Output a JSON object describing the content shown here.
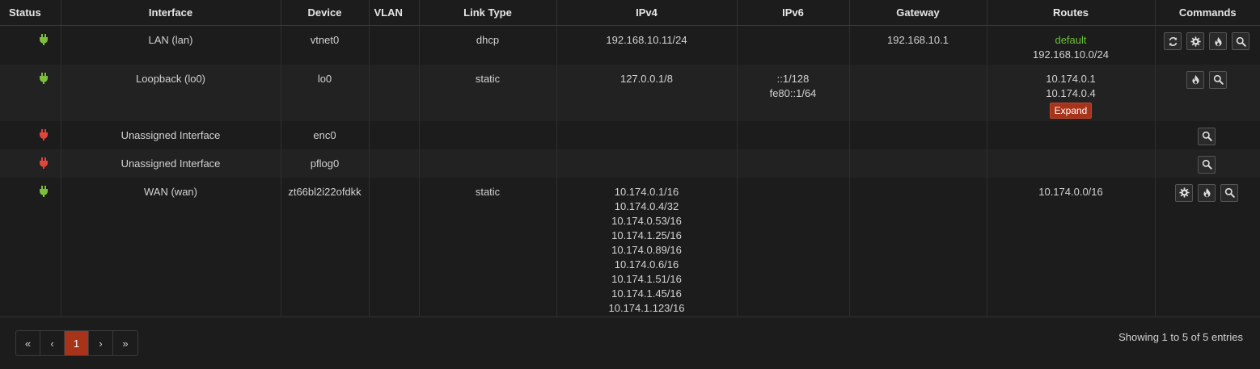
{
  "headers": {
    "status": "Status",
    "interface": "Interface",
    "device": "Device",
    "vlan": "VLAN",
    "link_type": "Link Type",
    "ipv4": "IPv4",
    "ipv6": "IPv6",
    "gateway": "Gateway",
    "routes": "Routes",
    "commands": "Commands"
  },
  "colors": {
    "status_up": "#7cbf3c",
    "status_down": "#e0463c",
    "accent": "#a8331b",
    "default_route": "#6fbf3a"
  },
  "rows": [
    {
      "status": "up",
      "interface": "LAN (lan)",
      "device": "vtnet0",
      "vlan": "",
      "link_type": "dhcp",
      "ipv4": [
        "192.168.10.11/24"
      ],
      "ipv6": [],
      "gateway": "192.168.10.1",
      "routes_default": "default",
      "routes": [
        "192.168.10.0/24"
      ],
      "expand_label": "",
      "commands": [
        "reload-icon",
        "gear-icon",
        "fire-icon",
        "search-icon"
      ]
    },
    {
      "status": "up",
      "interface": "Loopback (lo0)",
      "device": "lo0",
      "vlan": "",
      "link_type": "static",
      "ipv4": [
        "127.0.0.1/8"
      ],
      "ipv6": [
        "::1/128",
        "fe80::1/64"
      ],
      "gateway": "",
      "routes_default": "",
      "routes": [
        "10.174.0.1",
        "10.174.0.4"
      ],
      "expand_label": "Expand",
      "commands": [
        "fire-icon",
        "search-icon"
      ]
    },
    {
      "status": "down",
      "interface": "Unassigned Interface",
      "device": "enc0",
      "vlan": "",
      "link_type": "",
      "ipv4": [],
      "ipv6": [],
      "gateway": "",
      "routes_default": "",
      "routes": [],
      "expand_label": "",
      "commands": [
        "search-icon"
      ]
    },
    {
      "status": "down",
      "interface": "Unassigned Interface",
      "device": "pflog0",
      "vlan": "",
      "link_type": "",
      "ipv4": [],
      "ipv6": [],
      "gateway": "",
      "routes_default": "",
      "routes": [],
      "expand_label": "",
      "commands": [
        "search-icon"
      ]
    },
    {
      "status": "up",
      "interface": "WAN (wan)",
      "device": "zt66bl2i22ofdkk",
      "vlan": "",
      "link_type": "static",
      "ipv4": [
        "10.174.0.1/16",
        "10.174.0.4/32",
        "10.174.0.53/16",
        "10.174.1.25/16",
        "10.174.0.89/16",
        "10.174.0.6/16",
        "10.174.1.51/16",
        "10.174.1.45/16",
        "10.174.1.123/16"
      ],
      "ipv6": [],
      "gateway": "",
      "routes_default": "",
      "routes": [
        "10.174.0.0/16"
      ],
      "expand_label": "",
      "commands": [
        "gear-icon",
        "fire-icon",
        "search-icon"
      ]
    }
  ],
  "pagination": {
    "first": "«",
    "prev": "‹",
    "current": "1",
    "next": "›",
    "last": "»"
  },
  "entries_info": "Showing 1 to 5 of 5 entries"
}
